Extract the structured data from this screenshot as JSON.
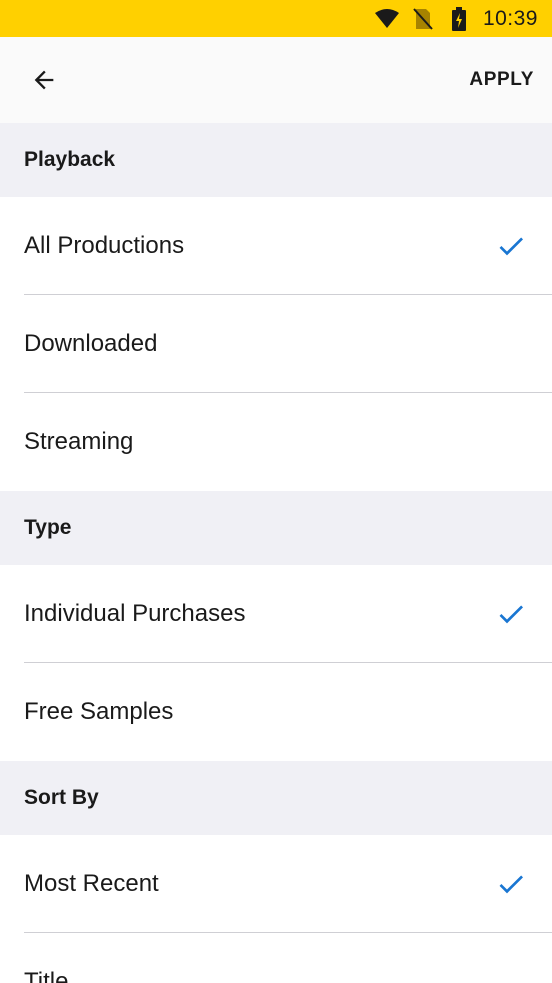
{
  "status_bar": {
    "time": "10:39"
  },
  "toolbar": {
    "apply_label": "APPLY"
  },
  "sections": {
    "playback": {
      "title": "Playback",
      "options": [
        {
          "label": "All Productions",
          "selected": true
        },
        {
          "label": "Downloaded",
          "selected": false
        },
        {
          "label": "Streaming",
          "selected": false
        }
      ]
    },
    "type": {
      "title": "Type",
      "options": [
        {
          "label": "Individual Purchases",
          "selected": true
        },
        {
          "label": "Free Samples",
          "selected": false
        }
      ]
    },
    "sort_by": {
      "title": "Sort By",
      "options": [
        {
          "label": "Most Recent",
          "selected": true
        },
        {
          "label": "Title",
          "selected": false
        }
      ]
    }
  },
  "colors": {
    "accent": "#1976d2",
    "status_bar": "#ffd000"
  },
  "icons": {
    "back": "arrow-left-icon",
    "check": "check-icon"
  }
}
